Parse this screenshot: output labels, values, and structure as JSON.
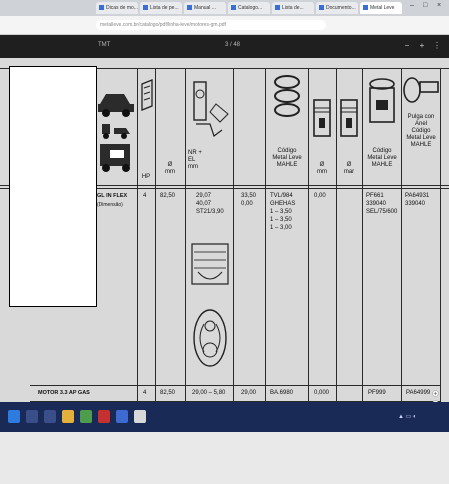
{
  "browser": {
    "tabs": [
      "Dicas de mo...",
      "Lista de pe...",
      "Manual ...",
      "Catalogo...",
      "Lista de...",
      "Documento...",
      "Metal Leve"
    ],
    "active_tab_index": 6,
    "url": "metalleve.com.br/catalogo/pdf/linha-leve/motores-gm.pdf",
    "window_controls": [
      "–",
      "□",
      "×"
    ]
  },
  "viewer": {
    "left_label": "TMT",
    "page_indicator": "3 / 48",
    "buttons": [
      "−",
      "+",
      "⋮"
    ]
  },
  "table": {
    "header_labels": {
      "col_hp": "HP",
      "col_d1": "Ø\nmm",
      "col_sensor": "NR +\nEL\nmm",
      "col_ring_codes": "Código\nMetal Leve\nMAHLE",
      "col_d2": "Ø\nmm",
      "col_d3": "Ø\nmar",
      "col_piston_codes": "Código\nMetal Leve\nMAHLE",
      "col_pin_codes": "Pulga con\nAnel\nCódigo\nMetal Leve\nMAHLE"
    },
    "row1": {
      "engine": "GL IN FLEX",
      "engine_sub": "(Dimensão)",
      "cyl": "4",
      "bore": "82,50",
      "spec_a": "29,07\n40,07\nST21/3,90",
      "spec_b": "33,50\n0,00",
      "ring_ref": "TVL/984\nGHEHAS\n1 – 3,50\n1 – 3,50\n1 – 3,00",
      "d2": "0,00",
      "piston_ref": "PF661\n339040\nSEL/75/600",
      "pin_ref": "PA64931\n339040"
    },
    "footer_row": {
      "engine": "MOTOR 3.3 AP GAS",
      "cyl": "4",
      "bore": "82,50",
      "spec_a": "29,00 – 5,80",
      "spec_b": "29,00",
      "ring_ref": "BA.6980",
      "d2": "0,000",
      "piston_ref": "PF999",
      "pin_ref": "PA64999"
    }
  },
  "colors": {
    "tabbar": "#cfd3d8",
    "appbar": "#1f1f1f",
    "document": "#d9d9d9",
    "taskbar": "#1a2a56"
  },
  "taskbar": {
    "icons": [
      "start-icon",
      "search-icon",
      "task-view-icon",
      "explorer-icon",
      "chrome-icon",
      "pdf-icon",
      "word-icon",
      "app-icon"
    ]
  }
}
